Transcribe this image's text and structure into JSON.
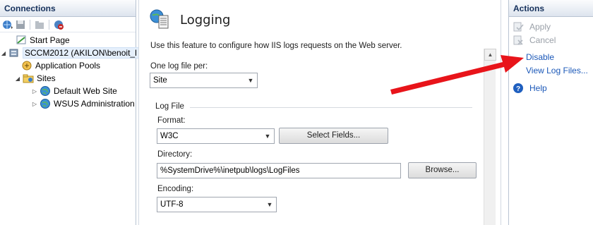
{
  "connections": {
    "header": "Connections",
    "tree": [
      {
        "label": "Start Page",
        "icon": "start-page-icon",
        "expander": ""
      },
      {
        "label": "SCCM2012 (AKILON\\benoit_l",
        "icon": "server-icon",
        "expander": "◢"
      },
      {
        "label": "Application Pools",
        "icon": "app-pools-icon",
        "expander": ""
      },
      {
        "label": "Sites",
        "icon": "sites-folder-icon",
        "expander": "◢"
      },
      {
        "label": "Default Web Site",
        "icon": "globe-icon",
        "expander": "▷"
      },
      {
        "label": "WSUS Administration",
        "icon": "globe-icon",
        "expander": "▷"
      }
    ]
  },
  "main": {
    "title": "Logging",
    "description": "Use this feature to configure how IIS logs requests on the Web server.",
    "one_log_label": "One log file per:",
    "one_log_value": "Site",
    "log_file_group": "Log File",
    "format_label": "Format:",
    "format_value": "W3C",
    "select_fields_button": "Select Fields...",
    "directory_label": "Directory:",
    "directory_value": "%SystemDrive%\\inetpub\\logs\\LogFiles",
    "browse_button": "Browse...",
    "encoding_label": "Encoding:",
    "encoding_value": "UTF-8"
  },
  "actions": {
    "header": "Actions",
    "items": [
      {
        "label": "Apply",
        "icon": "apply-icon",
        "enabled": false
      },
      {
        "label": "Cancel",
        "icon": "cancel-icon",
        "enabled": false
      },
      {
        "label": "Disable",
        "icon": "",
        "enabled": true
      },
      {
        "label": "View Log Files...",
        "icon": "",
        "enabled": true
      },
      {
        "label": "Help",
        "icon": "help-icon",
        "enabled": true
      }
    ]
  },
  "colors": {
    "link": "#1b58b8",
    "disabled": "#9aa0a8",
    "header_text": "#15305b",
    "arrow": "#e8141a"
  }
}
